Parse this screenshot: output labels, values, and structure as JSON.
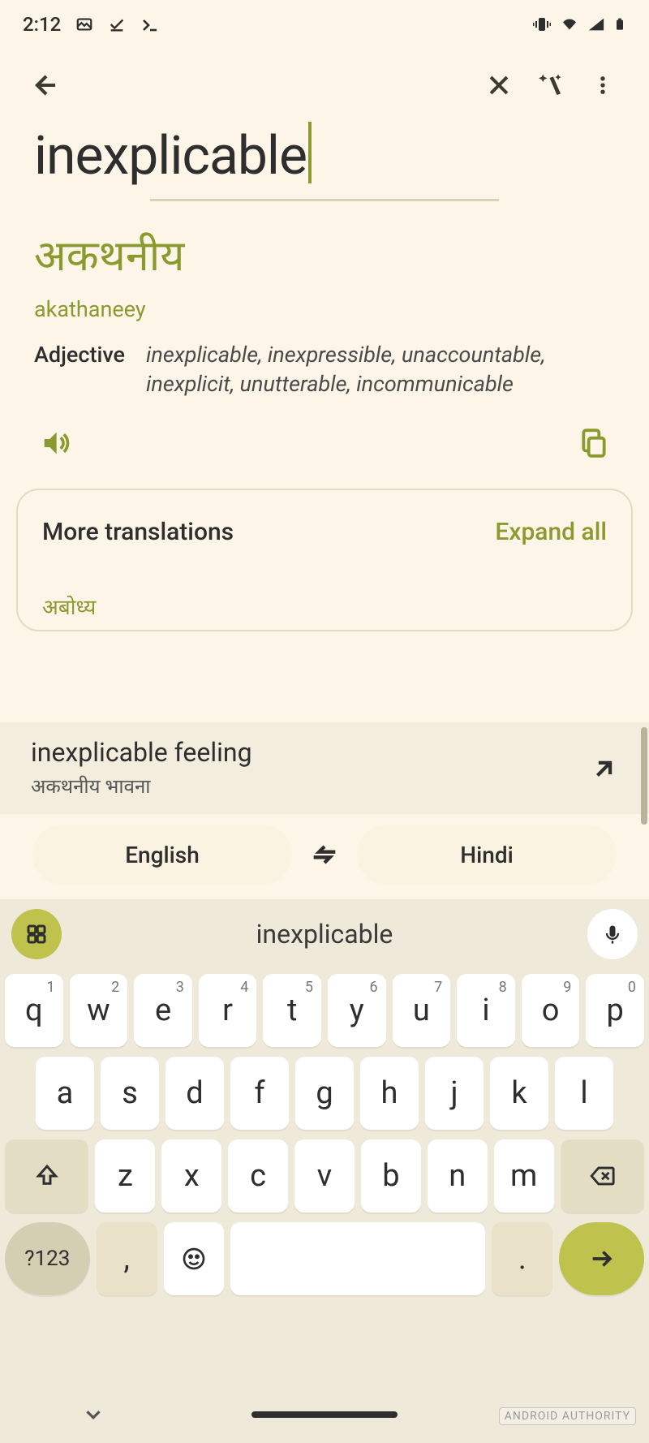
{
  "status": {
    "time": "2:12"
  },
  "input": {
    "source_text": "inexplicable"
  },
  "translation": {
    "target_script": "अकथनीय",
    "transliteration": "akathaneey",
    "pos": "Adjective",
    "synonyms": "inexplicable, inexpressible, unaccountable, inexplicit, unutterable, incommunicable"
  },
  "more": {
    "title": "More translations",
    "expand": "Expand all",
    "item1": "अबोध्य"
  },
  "suggestion": {
    "primary": "inexplicable feeling",
    "secondary": "अकथनीय भावना"
  },
  "langs": {
    "source": "English",
    "target": "Hindi"
  },
  "keyboard": {
    "suggestion_word": "inexplicable",
    "row1": [
      "q",
      "w",
      "e",
      "r",
      "t",
      "y",
      "u",
      "i",
      "o",
      "p"
    ],
    "row1_sup": [
      "1",
      "2",
      "3",
      "4",
      "5",
      "6",
      "7",
      "8",
      "9",
      "0"
    ],
    "row2": [
      "a",
      "s",
      "d",
      "f",
      "g",
      "h",
      "j",
      "k",
      "l"
    ],
    "row3": [
      "z",
      "x",
      "c",
      "v",
      "b",
      "n",
      "m"
    ],
    "sym": "?123",
    "comma": ",",
    "period": "."
  },
  "watermark": "ANDROID AUTHORITY"
}
